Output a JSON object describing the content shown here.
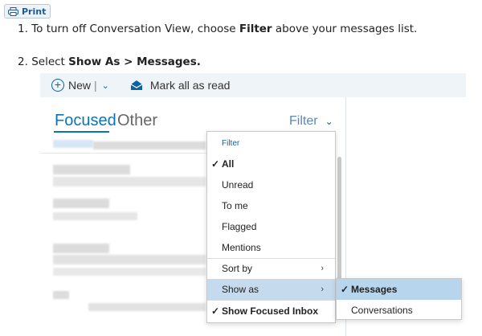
{
  "print_button": {
    "label": "Print"
  },
  "steps": [
    {
      "number": "1.",
      "prefix": "To turn off Conversation View, choose ",
      "bold": "Filter",
      "suffix": " above your messages list."
    },
    {
      "number": "2.",
      "prefix": "Select ",
      "bold": "Show As > Messages.",
      "suffix": ""
    }
  ],
  "toolbar": {
    "new_label": "New",
    "separator": "|",
    "mark_all_label": "Mark all as read"
  },
  "tabs": {
    "focused": "Focused",
    "other": "Other"
  },
  "filter_label": "Filter",
  "filter_menu": {
    "header": "Filter",
    "items": [
      "All",
      "Unread",
      "To me",
      "Flagged",
      "Mentions"
    ],
    "selected": "All",
    "sort_by": "Sort by",
    "show_as": "Show as",
    "show_focused": "Show Focused Inbox"
  },
  "show_as_menu": {
    "items": [
      "Messages",
      "Conversations"
    ],
    "selected": "Messages"
  },
  "colors": {
    "accent": "#0a74b8",
    "highlight": "#c5dbed",
    "toolbar_bg": "#eef4f8"
  }
}
